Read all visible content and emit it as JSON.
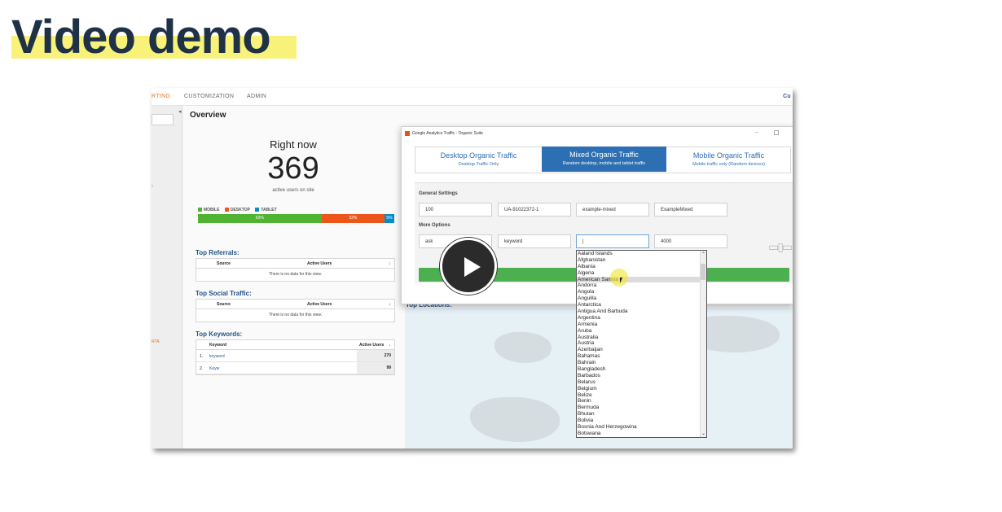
{
  "headline": {
    "text": "Video demo"
  },
  "ga": {
    "nav": {
      "reporting": "RTING",
      "customization": "CUSTOMIZATION",
      "admin": "ADMIN",
      "right_cut": "Cu"
    },
    "left": {
      "collapse": "◂",
      "mark1": "‹",
      "mark2": "RTA"
    },
    "overview": "Overview",
    "right_now": {
      "title": "Right now",
      "count": "369",
      "sub": "active users on site"
    },
    "device_legend": {
      "mobile": "MOBILE",
      "desktop": "DESKTOP",
      "tablet": "TABLET"
    },
    "device_split": {
      "mobile": 63,
      "desktop": 32,
      "tablet": 5,
      "mobile_label": "63%",
      "desktop_label": "32%",
      "tablet_label": "5%"
    },
    "colors": {
      "mobile": "#50b432",
      "desktop": "#ed561b",
      "tablet": "#058dc7"
    },
    "top_referrals": {
      "title": "Top Referrals:",
      "col1": "Source",
      "col2": "Active Users",
      "sort": "↓",
      "nodata": "There is no data for this view."
    },
    "top_social": {
      "title": "Top Social Traffic:",
      "col1": "Source",
      "col2": "Active Users",
      "sort": "↓",
      "nodata": "There is no data for this view."
    },
    "top_keywords": {
      "title": "Top Keywords:",
      "col1": "Keyword",
      "col2": "Active Users",
      "sort": "↓",
      "rows": [
        {
          "num": "1.",
          "keyword": "keyword",
          "value": "270"
        },
        {
          "num": "2.",
          "keyword": "Keyw",
          "value": "99"
        }
      ]
    },
    "top_locations": "Top Locations:"
  },
  "suite": {
    "title": "Google Analytics Traffic - Organic Suite",
    "min": "–",
    "tabs": [
      {
        "title": "Desktop Organic Traffic",
        "sub": "Desktop Traffic Only"
      },
      {
        "title": "Mixed Organic Traffic",
        "sub": "Random desktop, mobile and tablet traffic"
      },
      {
        "title": "Mobile Organic Traffic",
        "sub": "Mobile traffic only (Random devices)"
      }
    ],
    "general_label": "General Settings",
    "general_fields": [
      "100",
      "UA-91022372-1",
      "example-mixed",
      "ExampleMixed"
    ],
    "more_label": "More Options",
    "more_fields": [
      "ask",
      "keyword",
      "|",
      "4000"
    ],
    "devices_icon": "▭▯▭",
    "scroll_up": "⌃",
    "scroll_down": "⌄"
  },
  "countries": [
    "Aaland Islands",
    "Afghanistan",
    "Albania",
    "Algeria",
    "American Samoa",
    "Andorra",
    "Angola",
    "Anguilla",
    "Antarctica",
    "Antigua And Barbuda",
    "Argentina",
    "Armenia",
    "Aruba",
    "Australia",
    "Austria",
    "Azerbaijan",
    "Bahamas",
    "Bahrain",
    "Bangladesh",
    "Barbados",
    "Belarus",
    "Belgium",
    "Belize",
    "Benin",
    "Bermuda",
    "Bhutan",
    "Bolivia",
    "Bosnia And Herzegowina",
    "Botswana"
  ],
  "highlighted_country_index": 4
}
